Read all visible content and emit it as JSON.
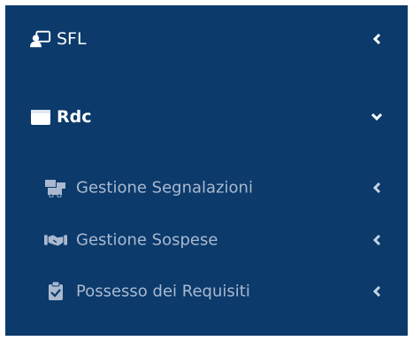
{
  "sidebar": {
    "items": [
      {
        "label": "SFL",
        "icon": "user-screen-icon",
        "chevron": "chevron-left-icon"
      },
      {
        "label": "Rdc",
        "icon": "wallet-icon",
        "chevron": "chevron-down-icon",
        "expanded": true
      }
    ],
    "subitems": [
      {
        "label": "Gestione Segnalazioni",
        "icon": "shipping-icon",
        "chevron": "chevron-left-icon"
      },
      {
        "label": "Gestione Sospese",
        "icon": "handshake-icon",
        "chevron": "chevron-left-icon"
      },
      {
        "label": "Possesso dei Requisiti",
        "icon": "clipboard-check-icon",
        "chevron": "chevron-left-icon"
      }
    ]
  },
  "colors": {
    "background": "#0b3a6b",
    "text_primary": "#ffffff",
    "text_secondary": "#aab9cf"
  }
}
